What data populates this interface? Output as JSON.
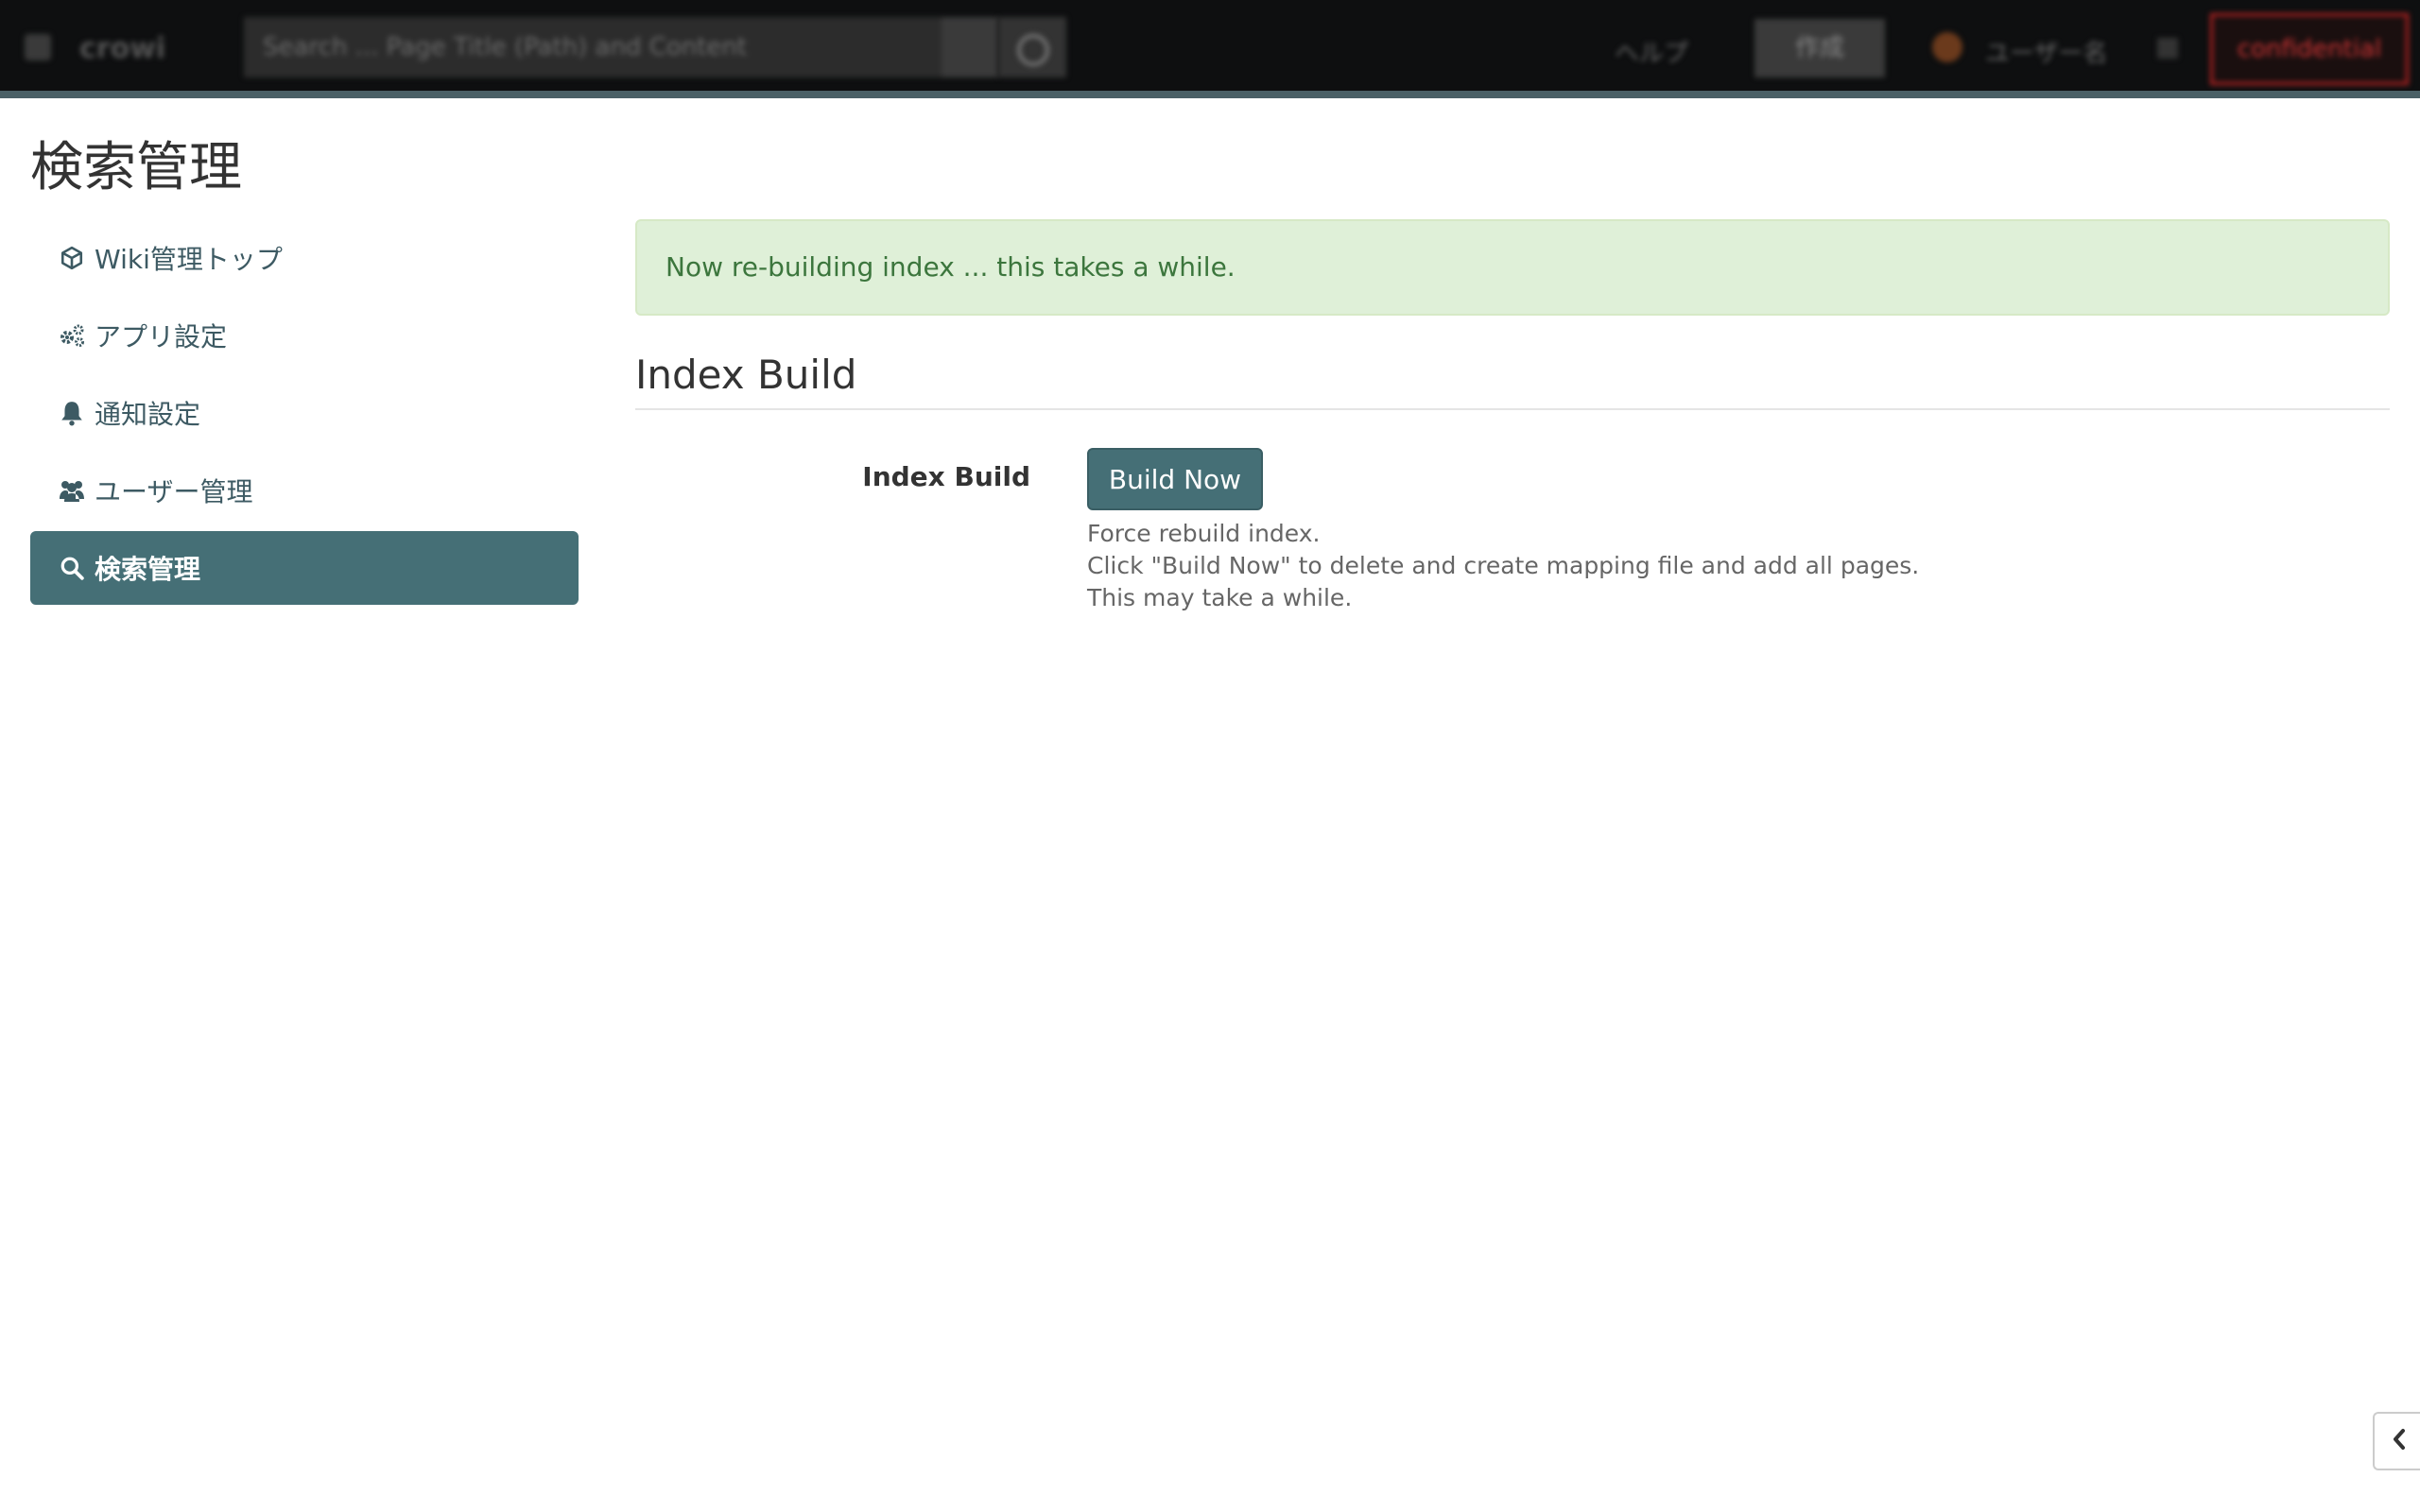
{
  "navbar": {
    "brand": "crowi",
    "search_placeholder": "Search ... Page Title (Path) and Content",
    "help": "ヘルプ",
    "create": "作成",
    "user": "ユーザー名",
    "confidential": "confidential"
  },
  "page_title": "検索管理",
  "sidebar": {
    "items": [
      {
        "label": "Wiki管理トップ",
        "icon": "cube-icon",
        "active": false
      },
      {
        "label": "アプリ設定",
        "icon": "gears-icon",
        "active": false
      },
      {
        "label": "通知設定",
        "icon": "bell-icon",
        "active": false
      },
      {
        "label": "ユーザー管理",
        "icon": "users-icon",
        "active": false
      },
      {
        "label": "検索管理",
        "icon": "search-icon",
        "active": true
      }
    ]
  },
  "alert": {
    "message": "Now re-building index ... this takes a while."
  },
  "section": {
    "title": "Index Build",
    "field_label": "Index Build",
    "button_label": "Build Now",
    "help_lines": [
      "Force rebuild index.",
      "Click \"Build Now\" to delete and create mapping file and add all pages.",
      "This may take a while."
    ]
  },
  "colors": {
    "accent": "#456f76",
    "link": "#3d5a63",
    "alert_bg": "#dff0d8",
    "alert_text": "#3c763d"
  }
}
